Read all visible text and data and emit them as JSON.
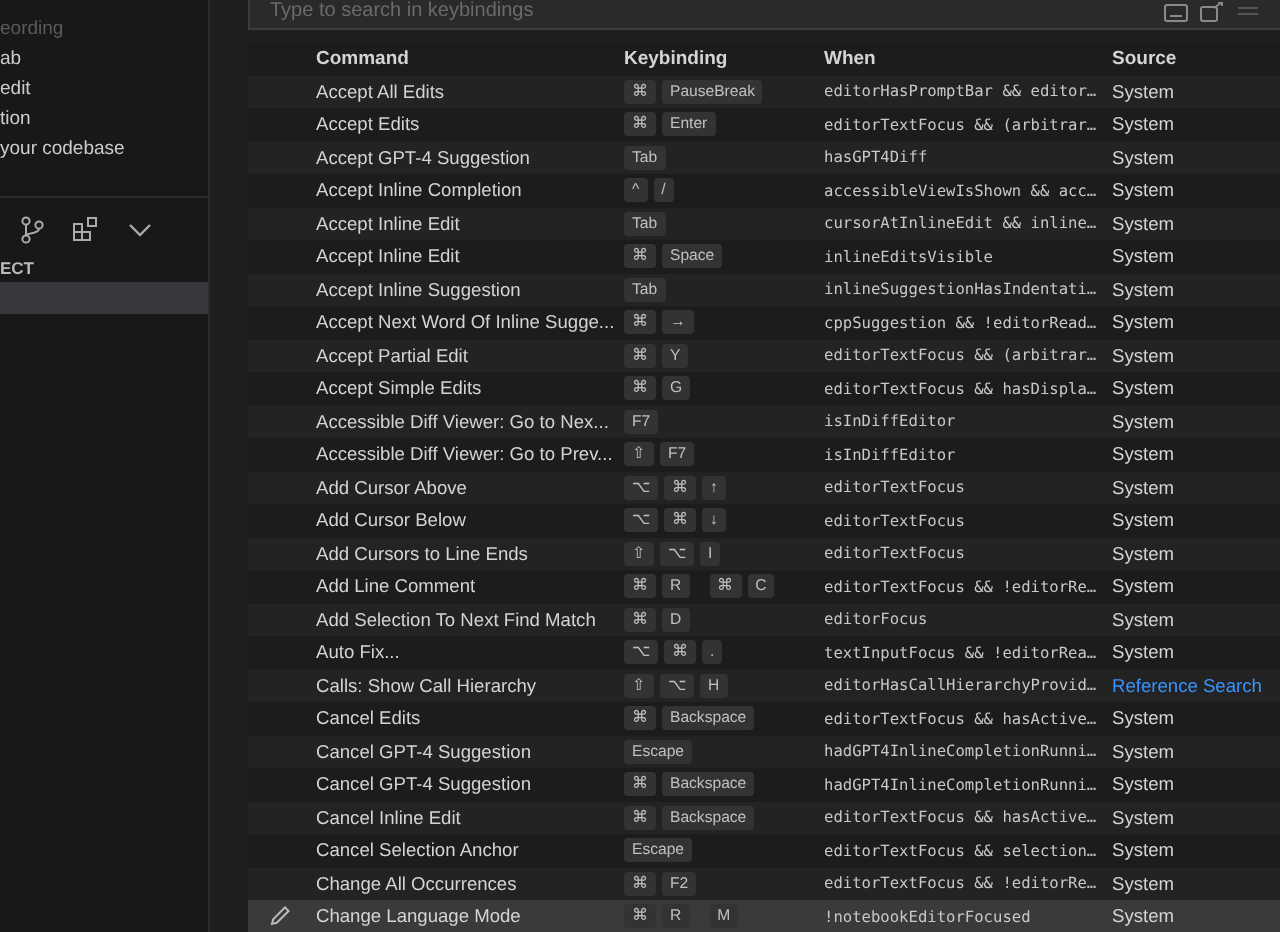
{
  "sidebar": {
    "items": [
      {
        "label": "eording",
        "dimmed": true
      },
      {
        "label": "ab",
        "dimmed": false
      },
      {
        "label": "edit",
        "dimmed": false
      },
      {
        "label": "tion",
        "dimmed": false
      },
      {
        "label": "your codebase",
        "dimmed": false
      }
    ],
    "section_title": "ECT"
  },
  "search": {
    "placeholder": "Type to search in keybindings"
  },
  "table": {
    "columns": [
      "Command",
      "Keybinding",
      "When",
      "Source"
    ],
    "rows": [
      {
        "command": "Accept All Edits",
        "keybinding": [
          [
            "⌘",
            "PauseBreak"
          ]
        ],
        "when": "editorHasPromptBar && editor…",
        "source": "System",
        "link": false,
        "selected": false
      },
      {
        "command": "Accept Edits",
        "keybinding": [
          [
            "⌘",
            "Enter"
          ]
        ],
        "when": "editorTextFocus && (arbitrar…",
        "source": "System",
        "link": false,
        "selected": false
      },
      {
        "command": "Accept GPT-4 Suggestion",
        "keybinding": [
          [
            "Tab"
          ]
        ],
        "when": "hasGPT4Diff",
        "source": "System",
        "link": false,
        "selected": false
      },
      {
        "command": "Accept Inline Completion",
        "keybinding": [
          [
            "^",
            "/"
          ]
        ],
        "when": "accessibleViewIsShown && acc…",
        "source": "System",
        "link": false,
        "selected": false
      },
      {
        "command": "Accept Inline Edit",
        "keybinding": [
          [
            "Tab"
          ]
        ],
        "when": "cursorAtInlineEdit && inline…",
        "source": "System",
        "link": false,
        "selected": false
      },
      {
        "command": "Accept Inline Edit",
        "keybinding": [
          [
            "⌘",
            "Space"
          ]
        ],
        "when": "inlineEditsVisible",
        "source": "System",
        "link": false,
        "selected": false
      },
      {
        "command": "Accept Inline Suggestion",
        "keybinding": [
          [
            "Tab"
          ]
        ],
        "when": "inlineSuggestionHasIndentati…",
        "source": "System",
        "link": false,
        "selected": false
      },
      {
        "command": "Accept Next Word Of Inline Sugge...",
        "keybinding": [
          [
            "⌘",
            "→"
          ]
        ],
        "when": "cppSuggestion && !editorRead…",
        "source": "System",
        "link": false,
        "selected": false
      },
      {
        "command": "Accept Partial Edit",
        "keybinding": [
          [
            "⌘",
            "Y"
          ]
        ],
        "when": "editorTextFocus && (arbitrar…",
        "source": "System",
        "link": false,
        "selected": false
      },
      {
        "command": "Accept Simple Edits",
        "keybinding": [
          [
            "⌘",
            "G"
          ]
        ],
        "when": "editorTextFocus && hasDispla…",
        "source": "System",
        "link": false,
        "selected": false
      },
      {
        "command": "Accessible Diff Viewer: Go to Nex...",
        "keybinding": [
          [
            "F7"
          ]
        ],
        "when": "isInDiffEditor",
        "source": "System",
        "link": false,
        "selected": false
      },
      {
        "command": "Accessible Diff Viewer: Go to Prev...",
        "keybinding": [
          [
            "⇧",
            "F7"
          ]
        ],
        "when": "isInDiffEditor",
        "source": "System",
        "link": false,
        "selected": false
      },
      {
        "command": "Add Cursor Above",
        "keybinding": [
          [
            "⌥",
            "⌘",
            "↑"
          ]
        ],
        "when": "editorTextFocus",
        "source": "System",
        "link": false,
        "selected": false
      },
      {
        "command": "Add Cursor Below",
        "keybinding": [
          [
            "⌥",
            "⌘",
            "↓"
          ]
        ],
        "when": "editorTextFocus",
        "source": "System",
        "link": false,
        "selected": false
      },
      {
        "command": "Add Cursors to Line Ends",
        "keybinding": [
          [
            "⇧",
            "⌥",
            "I"
          ]
        ],
        "when": "editorTextFocus",
        "source": "System",
        "link": false,
        "selected": false
      },
      {
        "command": "Add Line Comment",
        "keybinding": [
          [
            "⌘",
            "R"
          ],
          [
            "⌘",
            "C"
          ]
        ],
        "when": "editorTextFocus && !editorRe…",
        "source": "System",
        "link": false,
        "selected": false
      },
      {
        "command": "Add Selection To Next Find Match",
        "keybinding": [
          [
            "⌘",
            "D"
          ]
        ],
        "when": "editorFocus",
        "source": "System",
        "link": false,
        "selected": false
      },
      {
        "command": "Auto Fix...",
        "keybinding": [
          [
            "⌥",
            "⌘",
            "."
          ]
        ],
        "when": "textInputFocus && !editorRea…",
        "source": "System",
        "link": false,
        "selected": false
      },
      {
        "command": "Calls: Show Call Hierarchy",
        "keybinding": [
          [
            "⇧",
            "⌥",
            "H"
          ]
        ],
        "when": "editorHasCallHierarchyProvid…",
        "source": "Reference Search",
        "link": true,
        "selected": false
      },
      {
        "command": "Cancel Edits",
        "keybinding": [
          [
            "⌘",
            "Backspace"
          ]
        ],
        "when": "editorTextFocus && hasActive…",
        "source": "System",
        "link": false,
        "selected": false
      },
      {
        "command": "Cancel GPT-4 Suggestion",
        "keybinding": [
          [
            "Escape"
          ]
        ],
        "when": "hadGPT4InlineCompletionRunni…",
        "source": "System",
        "link": false,
        "selected": false
      },
      {
        "command": "Cancel GPT-4 Suggestion",
        "keybinding": [
          [
            "⌘",
            "Backspace"
          ]
        ],
        "when": "hadGPT4InlineCompletionRunni…",
        "source": "System",
        "link": false,
        "selected": false
      },
      {
        "command": "Cancel Inline Edit",
        "keybinding": [
          [
            "⌘",
            "Backspace"
          ]
        ],
        "when": "editorTextFocus && hasActive…",
        "source": "System",
        "link": false,
        "selected": false
      },
      {
        "command": "Cancel Selection Anchor",
        "keybinding": [
          [
            "Escape"
          ]
        ],
        "when": "editorTextFocus && selection…",
        "source": "System",
        "link": false,
        "selected": false
      },
      {
        "command": "Change All Occurrences",
        "keybinding": [
          [
            "⌘",
            "F2"
          ]
        ],
        "when": "editorTextFocus && !editorRe…",
        "source": "System",
        "link": false,
        "selected": false
      },
      {
        "command": "Change Language Mode",
        "keybinding": [
          [
            "⌘",
            "R"
          ],
          [
            "M"
          ]
        ],
        "when": "!notebookEditorFocused",
        "source": "System",
        "link": false,
        "selected": true
      }
    ]
  }
}
